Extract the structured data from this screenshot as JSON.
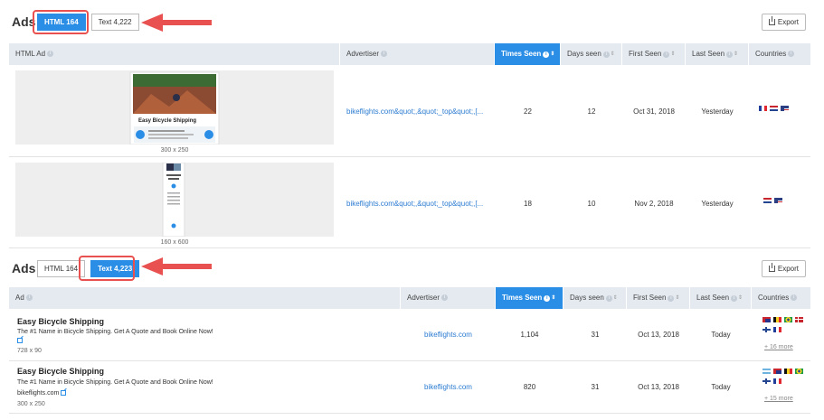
{
  "section1": {
    "title": "Ads",
    "tabs": [
      {
        "label": "HTML 164",
        "active": true
      },
      {
        "label": "Text 4,222",
        "active": false
      }
    ],
    "export_label": "Export",
    "columns": [
      {
        "label": "HTML Ad"
      },
      {
        "label": "Advertiser"
      },
      {
        "label": "Times Seen"
      },
      {
        "label": "Days seen"
      },
      {
        "label": "First Seen"
      },
      {
        "label": "Last Seen"
      },
      {
        "label": "Countries"
      }
    ],
    "rows": [
      {
        "ad_title": "Easy Bicycle Shipping",
        "ad_size": "300 x 250",
        "advertiser": "bikeflights.com&quot;,&quot;_top&quot;,[...",
        "times_seen": "22",
        "days_seen": "12",
        "first_seen": "Oct 31, 2018",
        "last_seen": "Yesterday",
        "flags": [
          "france",
          "netherlands",
          "usa"
        ]
      },
      {
        "ad_title": "Easy Bicycle Shipping",
        "ad_size": "160 x 600",
        "advertiser": "bikeflights.com&quot;,&quot;_top&quot;,[...",
        "times_seen": "18",
        "days_seen": "10",
        "first_seen": "Nov 2, 2018",
        "last_seen": "Yesterday",
        "flags": [
          "netherlands",
          "usa"
        ]
      }
    ]
  },
  "section2": {
    "title": "Ads",
    "tabs": [
      {
        "label": "HTML 164",
        "active": false
      },
      {
        "label": "Text 4,223",
        "active": true
      }
    ],
    "export_label": "Export",
    "columns": [
      {
        "label": "Ad"
      },
      {
        "label": "Advertiser"
      },
      {
        "label": "Times Seen"
      },
      {
        "label": "Days seen"
      },
      {
        "label": "First Seen"
      },
      {
        "label": "Last Seen"
      },
      {
        "label": "Countries"
      }
    ],
    "rows": [
      {
        "title": "Easy Bicycle Shipping",
        "body": "The #1 Name in Bicycle Shipping. Get A Quote and Book Online Now!",
        "display_url": "",
        "size": "728 x 90",
        "advertiser": "bikeflights.com",
        "times_seen": "1,104",
        "days_seen": "31",
        "first_seen": "Oct 13, 2018",
        "last_seen": "Today",
        "flags": [
          "australia",
          "belgium",
          "brazil",
          "denmark",
          "finland",
          "france"
        ],
        "more": "+ 16 more"
      },
      {
        "title": "Easy Bicycle Shipping",
        "body": "The #1 Name in Bicycle Shipping. Get A Quote and Book Online Now!",
        "display_url": "bikeflights.com",
        "size": "300 x 250",
        "advertiser": "bikeflights.com",
        "times_seen": "820",
        "days_seen": "31",
        "first_seen": "Oct 13, 2018",
        "last_seen": "Today",
        "flags": [
          "argentina",
          "australia",
          "belgium",
          "brazil",
          "finland",
          "france"
        ],
        "more": "+ 15 more"
      }
    ]
  },
  "colors": {
    "accent": "#2b8ee6",
    "highlight": "#e8514f",
    "header_bg": "#e4eaf0"
  }
}
